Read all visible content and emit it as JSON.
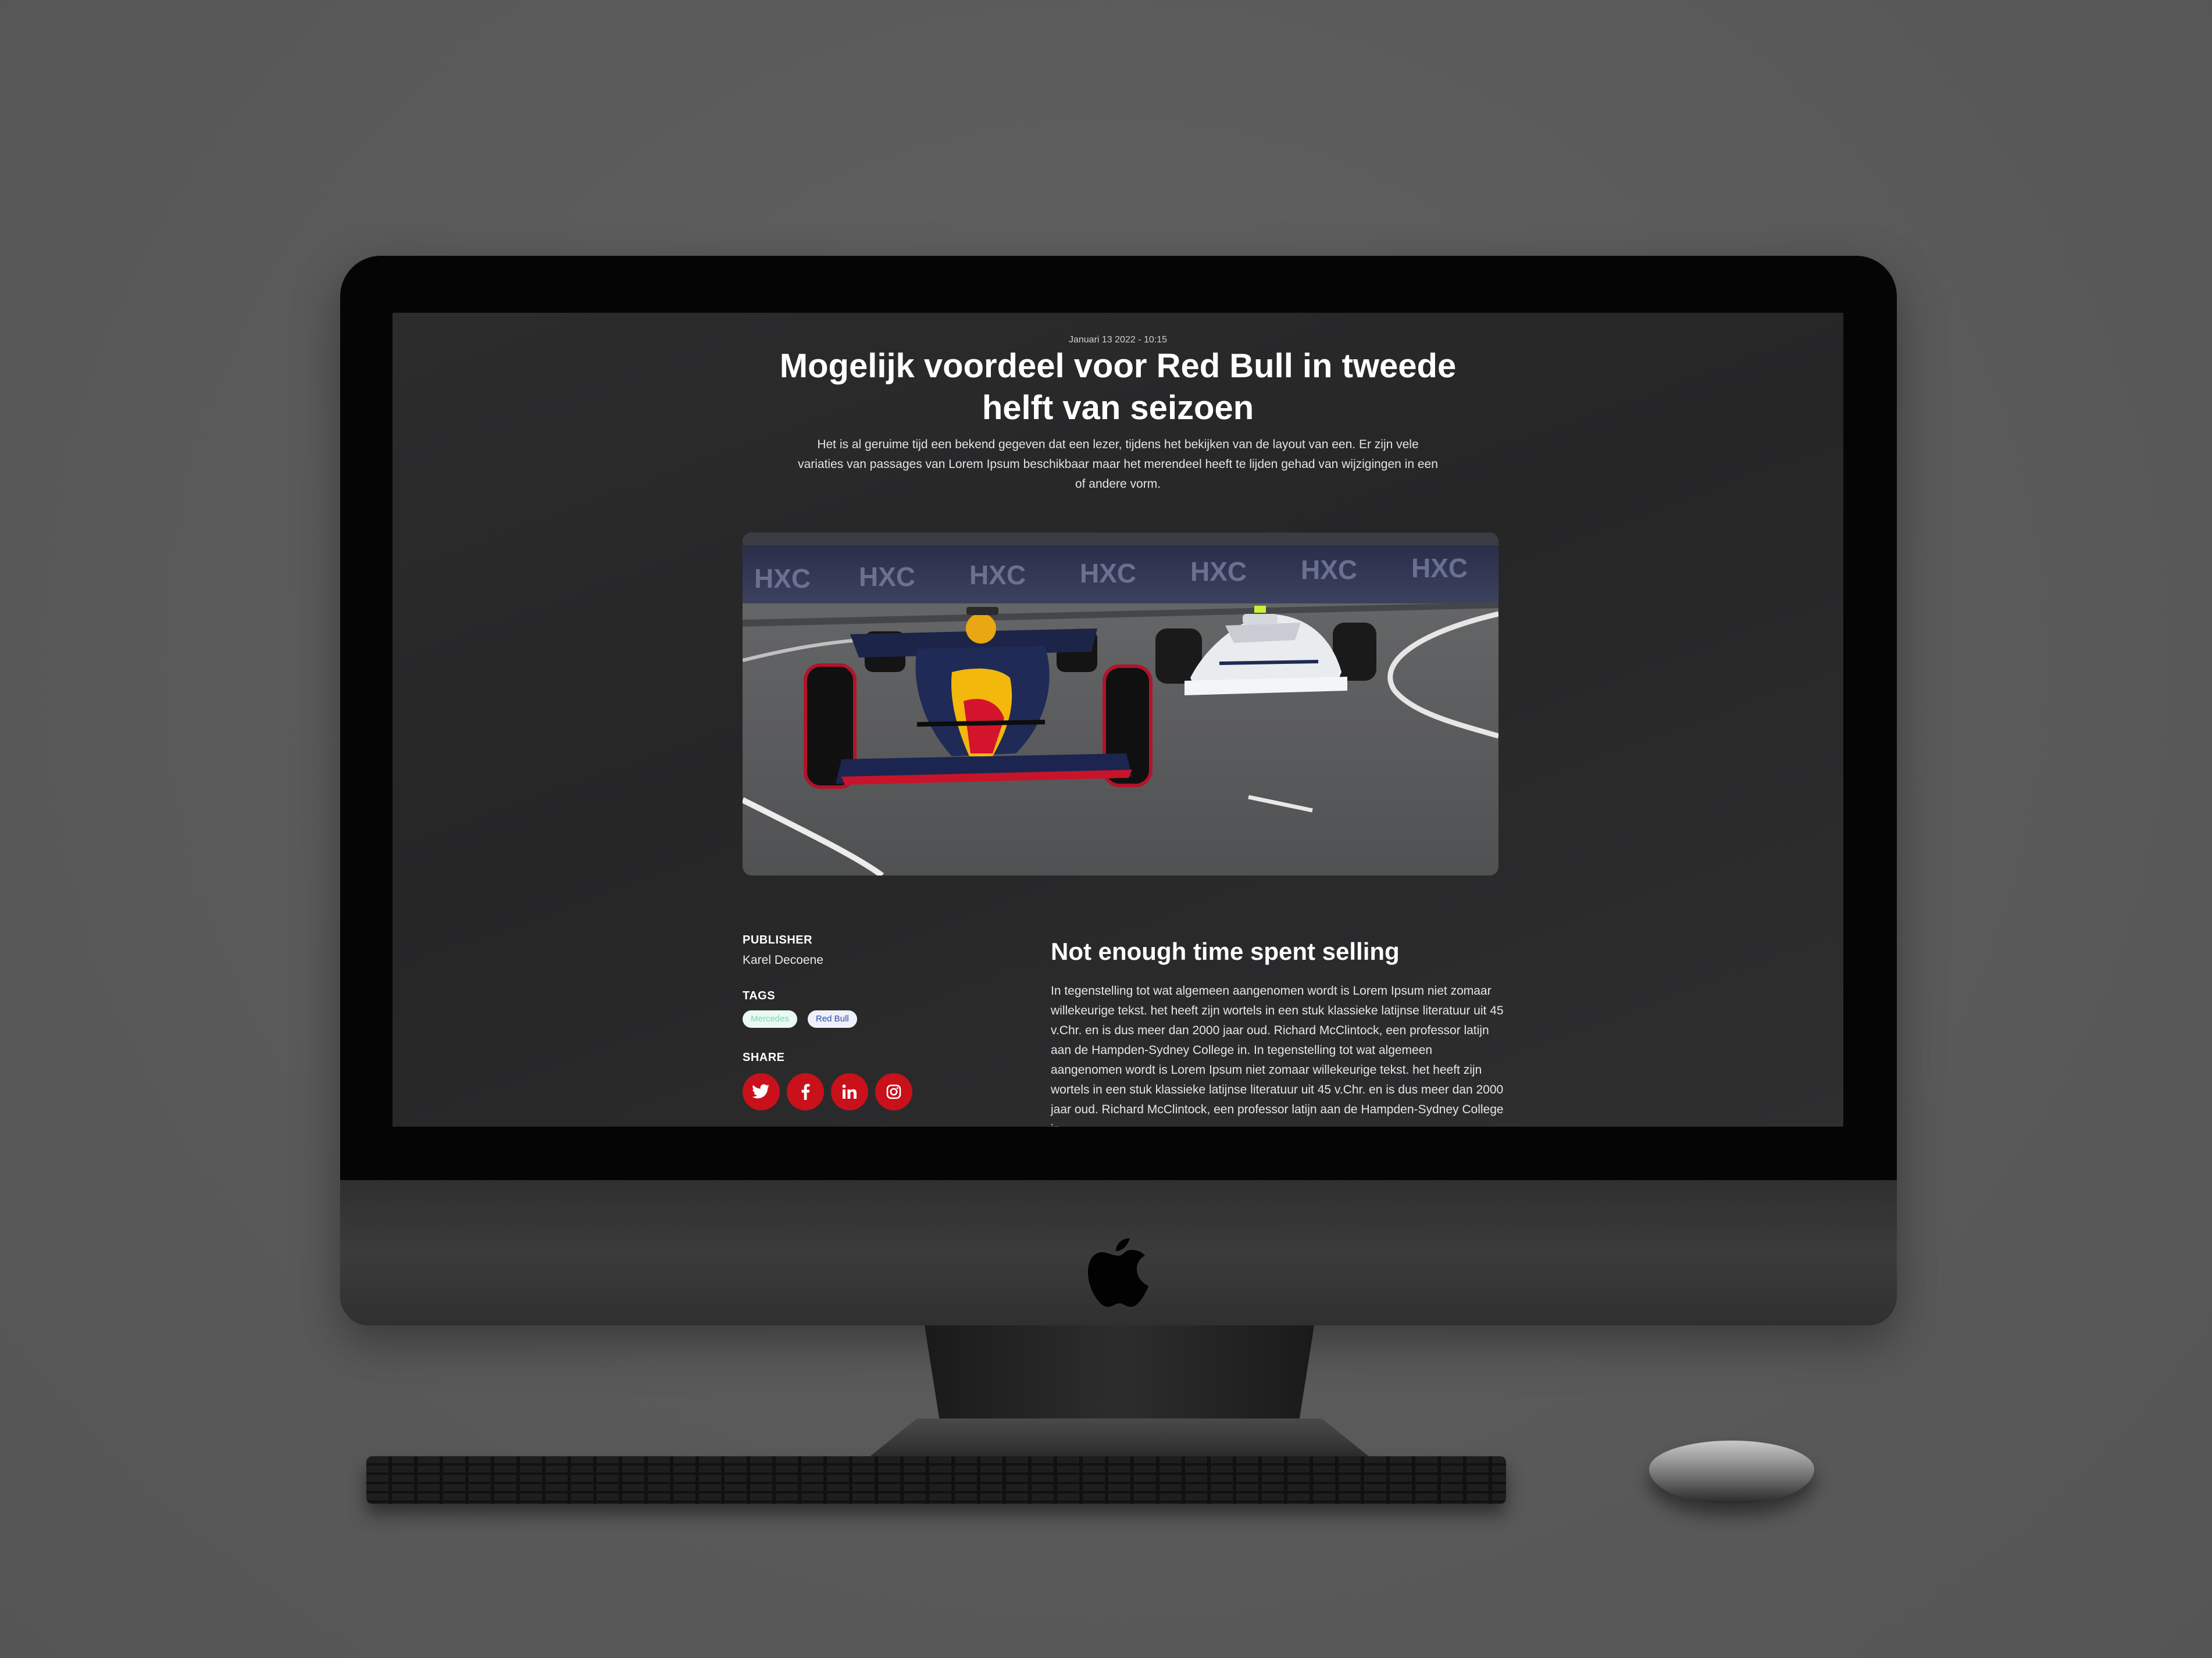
{
  "article": {
    "date": "Januari 13 2022 - 10:15",
    "title": "Mogelijk voordeel voor Red Bull in tweede helft van seizoen",
    "lead": "Het is al geruime tijd een bekend gegeven dat een lezer, tijdens het bekijken van de layout van een. Er zijn vele variaties van passages van Lorem Ipsum beschikbaar maar het merendeel heeft te lijden gehad van wijzigingen in een of andere vorm.",
    "hero_image": {
      "banner_text": "HXC"
    }
  },
  "sidebar": {
    "publisher_label": "PUBLISHER",
    "publisher_name": "Karel Decoene",
    "tags_label": "TAGS",
    "tags": [
      "Mercedes",
      "Red Bull"
    ],
    "share_label": "SHARE",
    "share_buttons": [
      {
        "network": "twitter",
        "glyph": "🐦",
        "icon": "twitter-icon"
      },
      {
        "network": "facebook",
        "glyph": "f",
        "icon": "facebook-icon"
      },
      {
        "network": "linkedin",
        "glyph": "in",
        "icon": "linkedin-icon"
      },
      {
        "network": "instagram",
        "glyph": "◎",
        "icon": "instagram-icon"
      }
    ]
  },
  "content": {
    "section_title": "Not enough time spent selling",
    "body": "In tegenstelling tot wat algemeen aangenomen wordt is Lorem Ipsum niet zomaar willekeurige tekst. het heeft zijn wortels in een stuk klassieke latijnse literatuur uit 45 v.Chr. en is dus meer dan 2000 jaar oud. Richard McClintock, een professor latijn aan de Hampden-Sydney College in. In tegenstelling tot wat algemeen aangenomen wordt is Lorem Ipsum niet zomaar willekeurige tekst. het heeft zijn wortels in een stuk klassieke latijnse literatuur uit 45 v.Chr. en is dus meer dan 2000 jaar oud. Richard McClintock, een professor latijn aan de Hampden-Sydney College in."
  },
  "colors": {
    "share_red": "#c8111a",
    "tag_mercedes_text": "#7fd3b0",
    "tag_redbull_text": "#2c4aa0",
    "page_background": "#2a2a2b"
  }
}
